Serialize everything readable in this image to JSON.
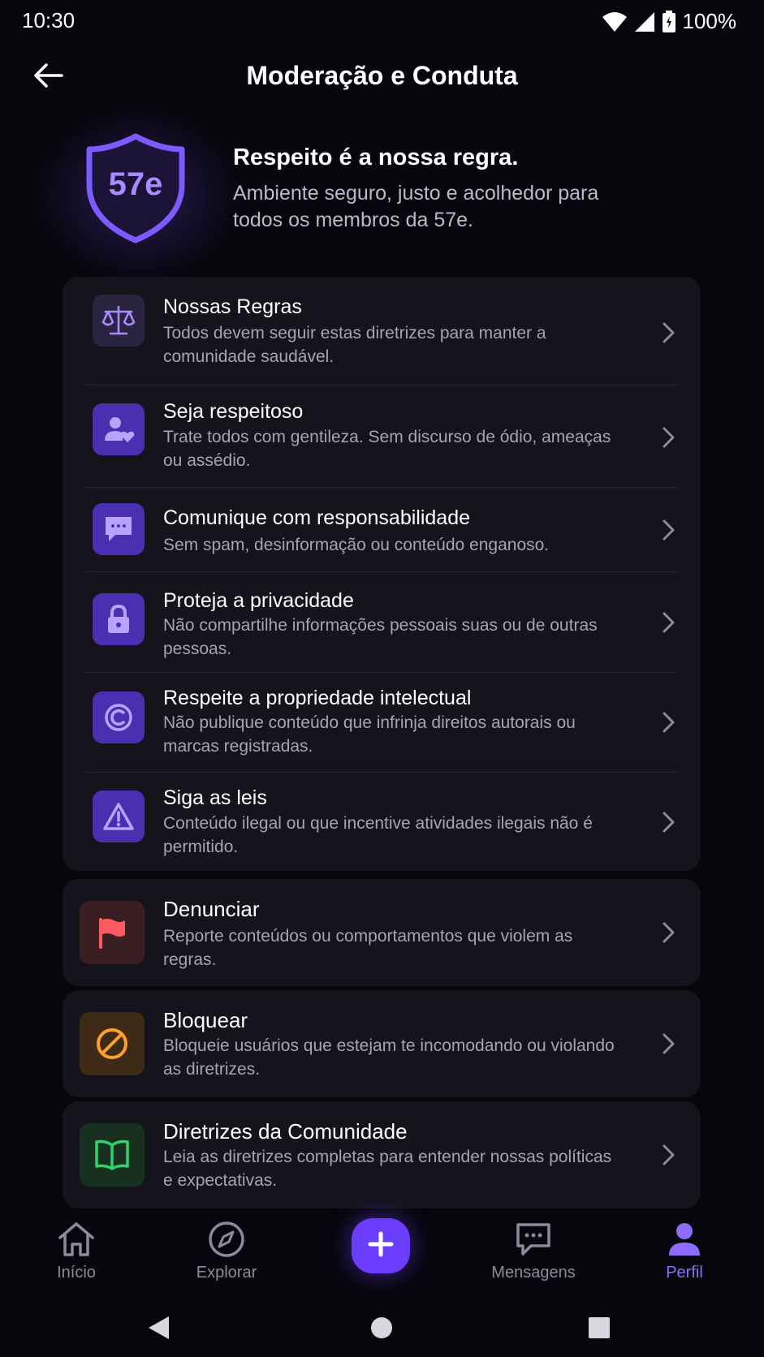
{
  "status_bar": {
    "time": "10:30",
    "battery": "100%"
  },
  "header": {
    "title": "Moderação e Conduta"
  },
  "hero": {
    "badge": "57e",
    "title": "Respeito é a nossa regra.",
    "description": "Ambiente seguro, justo e acolhedor para todos os membros da 57e."
  },
  "rules": [
    {
      "title": "Nossas Regras",
      "description": "Todos devem seguir estas diretrizes para manter a comunidade saudável.",
      "icon": "scale-icon"
    },
    {
      "title": "Seja respeitoso",
      "description": "Trate todos com gentileza. Sem discurso de ódio, ameaças ou assédio.",
      "icon": "user-heart-icon"
    },
    {
      "title": "Comunique com responsabilidade",
      "description": "Sem spam, desinformação ou conteúdo enganoso.",
      "icon": "chat-icon"
    },
    {
      "title": "Proteja a privacidade",
      "description": "Não compartilhe informações pessoais suas ou de outras pessoas.",
      "icon": "lock-icon"
    },
    {
      "title": "Respeite a propriedade intelectual",
      "description": "Não publique conteúdo que infrinja direitos autorais ou marcas registradas.",
      "icon": "copyright-icon"
    },
    {
      "title": "Siga as leis",
      "description": "Conteúdo ilegal ou que incentive atividades ilegais não é permitido.",
      "icon": "warning-icon"
    }
  ],
  "actions": [
    {
      "title": "Denunciar",
      "description": "Reporte conteúdos ou comportamentos que violem as regras.",
      "icon": "flag-icon",
      "color": "#ff5a5f"
    },
    {
      "title": "Bloquear",
      "description": "Bloqueie usuários que estejam te incomodando ou violando as diretrizes.",
      "icon": "block-icon",
      "color": "#ff9f2e"
    },
    {
      "title": "Diretrizes da Comunidade",
      "description": "Leia as diretrizes completas para entender nossas políticas e expectativas.",
      "icon": "book-icon",
      "color": "#2fd36b"
    }
  ],
  "bottom_nav": {
    "items": [
      {
        "label": "Início",
        "icon": "home-icon"
      },
      {
        "label": "Explorar",
        "icon": "compass-icon"
      },
      {
        "label": "Mensagens",
        "icon": "messages-icon"
      },
      {
        "label": "Perfil",
        "icon": "profile-icon",
        "active": true
      }
    ]
  },
  "colors": {
    "accent": "#6a3dff",
    "accent_light": "#8f6cff",
    "background": "#07060d",
    "card": "#15141d"
  }
}
